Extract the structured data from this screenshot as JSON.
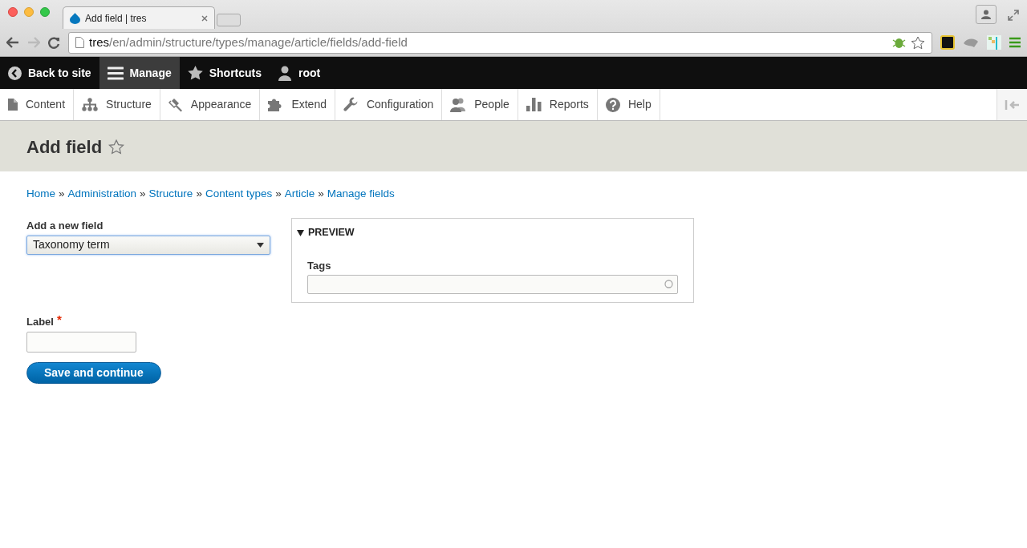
{
  "browser": {
    "tab_title": "Add field | tres",
    "url_host": "tres",
    "url_path": "/en/admin/structure/types/manage/article/fields/add-field"
  },
  "toolbar": {
    "items": [
      {
        "label": "Back to site",
        "kind": "back",
        "selected": false
      },
      {
        "label": "Manage",
        "kind": "menu",
        "selected": true
      },
      {
        "label": "Shortcuts",
        "kind": "star",
        "selected": false
      },
      {
        "label": "root",
        "kind": "user",
        "selected": false
      }
    ]
  },
  "tray": {
    "items": [
      {
        "label": "Content",
        "kind": "page"
      },
      {
        "label": "Structure",
        "kind": "tree"
      },
      {
        "label": "Appearance",
        "kind": "brush"
      },
      {
        "label": "Extend",
        "kind": "puzzle"
      },
      {
        "label": "Configuration",
        "kind": "wrench"
      },
      {
        "label": "People",
        "kind": "people"
      },
      {
        "label": "Reports",
        "kind": "bars"
      },
      {
        "label": "Help",
        "kind": "help"
      }
    ]
  },
  "page": {
    "title": "Add field",
    "breadcrumb": [
      {
        "label": "Home"
      },
      {
        "separator": "»",
        "label": "Administration"
      },
      {
        "separator": "»",
        "label": "Structure"
      },
      {
        "separator": "»",
        "label": "Content types"
      },
      {
        "separator": "»",
        "label": "Article"
      },
      {
        "separator": "»",
        "label": "Manage fields"
      }
    ]
  },
  "form": {
    "new_field": {
      "label": "Add a new field",
      "value": "Taxonomy term"
    },
    "preview": {
      "legend": "PREVIEW",
      "expanded": true,
      "field_label": "Tags"
    },
    "label_field": {
      "label": "Label",
      "required": true,
      "required_mark": "*"
    },
    "submit": "Save and continue"
  }
}
